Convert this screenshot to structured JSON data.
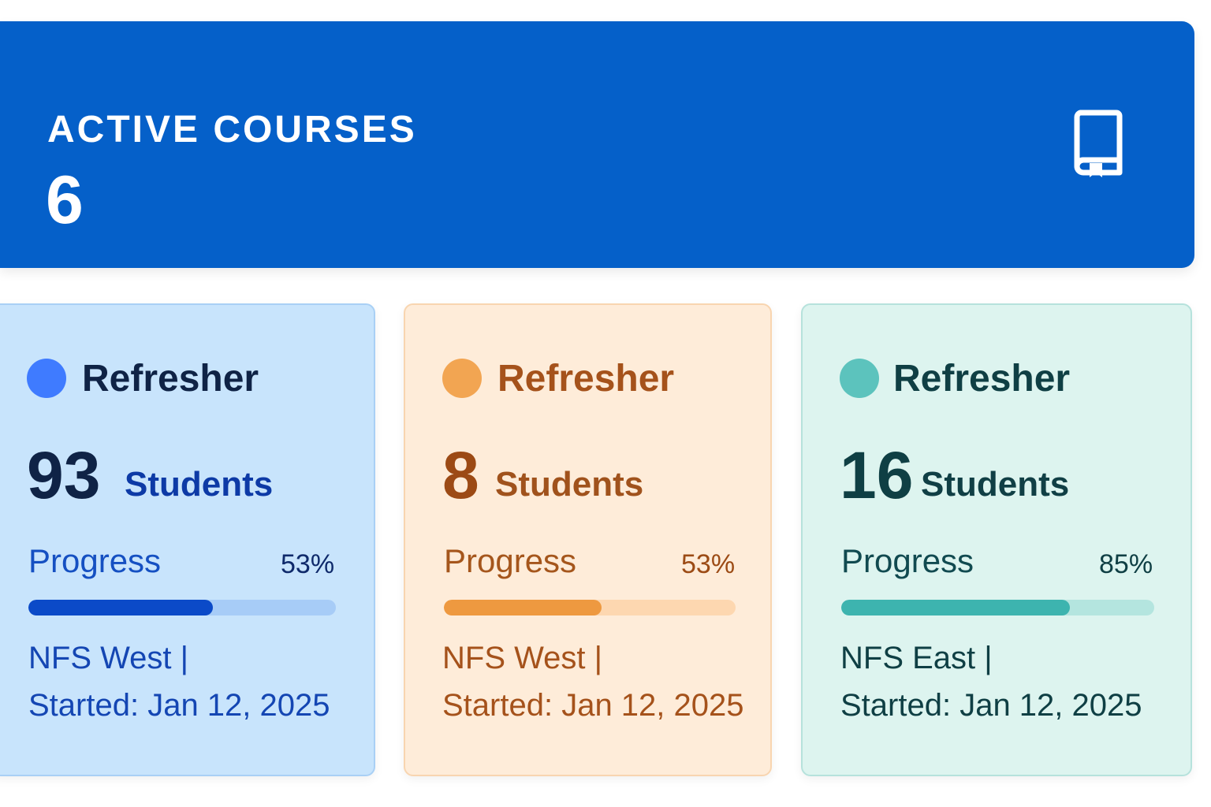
{
  "banner": {
    "title": "ACTIVE COURSES",
    "count": "6",
    "icon": "book-icon",
    "color": "#0560c9"
  },
  "cards": [
    {
      "title": "Refresher",
      "students": "93",
      "students_label": "Students",
      "progress_label": "Progress",
      "progress_pct": "53%",
      "progress": 0.6,
      "location": "NFS West |",
      "started": "Started: Jan 12, 2025",
      "accent": "#3f7bff"
    },
    {
      "title": "Refresher",
      "students": "8",
      "students_label": "Students",
      "progress_label": "Progress",
      "progress_pct": "53%",
      "progress": 0.54,
      "location": "NFS West |",
      "started": "Started: Jan 12, 2025",
      "accent": "#f2a552"
    },
    {
      "title": "Refresher",
      "students": "16",
      "students_label": "Students",
      "progress_label": "Progress",
      "progress_pct": "85%",
      "progress": 0.73,
      "location": "NFS East |",
      "started": "Started: Jan 12, 2025",
      "accent": "#5cc3bd"
    }
  ]
}
